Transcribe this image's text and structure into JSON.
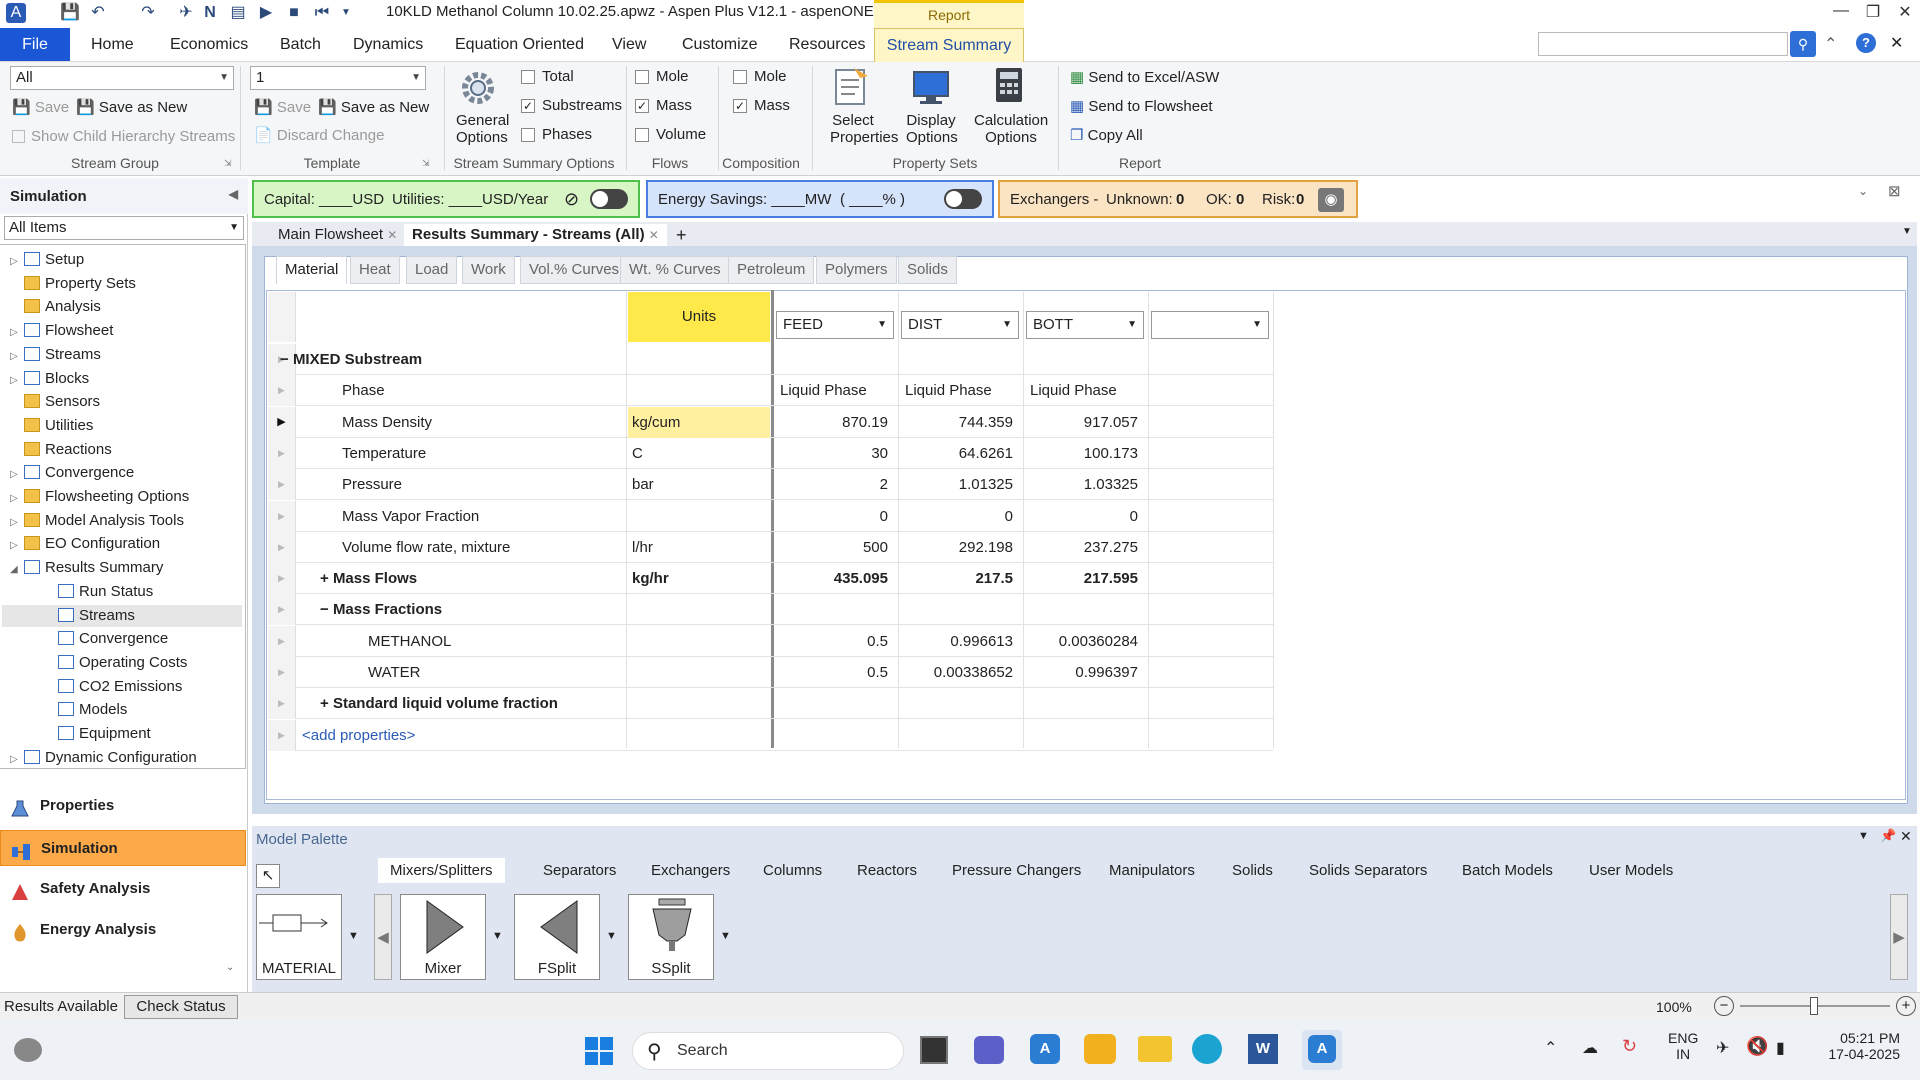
{
  "window": {
    "title": "10KLD Methanol Column 10.02.25.apwz - Aspen Plus V12.1 - aspenONE",
    "context_tab": "Report"
  },
  "ribbon_tabs": [
    "File",
    "Home",
    "Economics",
    "Batch",
    "Dynamics",
    "Equation Oriented",
    "View",
    "Customize",
    "Resources",
    "Stream Summary"
  ],
  "ribbon": {
    "stream_group": {
      "combo": "All",
      "save": "Save",
      "save_as_new": "Save as New",
      "show_child": "Show Child Hierarchy Streams",
      "label": "Stream Group"
    },
    "template": {
      "combo": "1",
      "save": "Save",
      "save_as_new": "Save as New",
      "discard": "Discard Change",
      "label": "Template"
    },
    "options": {
      "general": "General",
      "general2": "Options",
      "total": "Total",
      "substreams": "Substreams",
      "phases": "Phases",
      "label": "Stream Summary Options"
    },
    "flows": {
      "mole": "Mole",
      "mass": "Mass",
      "volume": "Volume",
      "label": "Flows"
    },
    "composition": {
      "mole": "Mole",
      "mass": "Mass",
      "label": "Composition"
    },
    "property_sets": {
      "select": "Select",
      "select2": "Properties",
      "display": "Display",
      "display2": "Options",
      "calc": "Calculation",
      "calc2": "Options",
      "label": "Property Sets"
    },
    "report": {
      "excel": "Send to Excel/ASW",
      "flowsheet": "Send to Flowsheet",
      "copy": "Copy All",
      "label": "Report"
    }
  },
  "nav": {
    "header": "Simulation",
    "filter": "All Items",
    "tree": [
      {
        "label": "Setup",
        "level": 0,
        "exp": true,
        "icon": "doc"
      },
      {
        "label": "Property Sets",
        "level": 0,
        "exp": false,
        "icon": "folder"
      },
      {
        "label": "Analysis",
        "level": 0,
        "exp": false,
        "icon": "folder"
      },
      {
        "label": "Flowsheet",
        "level": 0,
        "exp": true,
        "icon": "doc"
      },
      {
        "label": "Streams",
        "level": 0,
        "exp": true,
        "icon": "doc"
      },
      {
        "label": "Blocks",
        "level": 0,
        "exp": true,
        "icon": "doc"
      },
      {
        "label": "Sensors",
        "level": 0,
        "exp": false,
        "icon": "folder"
      },
      {
        "label": "Utilities",
        "level": 0,
        "exp": false,
        "icon": "folder"
      },
      {
        "label": "Reactions",
        "level": 0,
        "exp": false,
        "icon": "folder"
      },
      {
        "label": "Convergence",
        "level": 0,
        "exp": true,
        "icon": "doc"
      },
      {
        "label": "Flowsheeting Options",
        "level": 0,
        "exp": true,
        "icon": "folder"
      },
      {
        "label": "Model Analysis Tools",
        "level": 0,
        "exp": true,
        "icon": "folder"
      },
      {
        "label": "EO Configuration",
        "level": 0,
        "exp": true,
        "icon": "folder"
      },
      {
        "label": "Results Summary",
        "level": 0,
        "exp": true,
        "icon": "doc",
        "open": true
      },
      {
        "label": "Run Status",
        "level": 1,
        "icon": "doc"
      },
      {
        "label": "Streams",
        "level": 1,
        "icon": "doc",
        "selected": true
      },
      {
        "label": "Convergence",
        "level": 1,
        "icon": "doc"
      },
      {
        "label": "Operating Costs",
        "level": 1,
        "icon": "doc"
      },
      {
        "label": "CO2 Emissions",
        "level": 1,
        "icon": "doc"
      },
      {
        "label": "Models",
        "level": 1,
        "icon": "doc"
      },
      {
        "label": "Equipment",
        "level": 1,
        "icon": "doc"
      },
      {
        "label": "Dynamic Configuration",
        "level": 0,
        "exp": true,
        "icon": "doc"
      }
    ],
    "buttons": [
      "Properties",
      "Simulation",
      "Safety Analysis",
      "Energy Analysis"
    ]
  },
  "infobar": {
    "capital": "Capital: ____USD",
    "utilities": "Utilities: ____USD/Year",
    "energy": "Energy Savings: ____MW",
    "percent": "( ____% )",
    "exchangers": "Exchangers -",
    "unknown_label": "Unknown:",
    "unknown": "0",
    "ok_label": "OK:",
    "ok": "0",
    "risk_label": "Risk:",
    "risk": "0"
  },
  "doc_tabs": [
    "Main Flowsheet",
    "Results Summary - Streams (All)"
  ],
  "sub_tabs": [
    "Material",
    "Heat",
    "Load",
    "Work",
    "Vol.% Curves",
    "Wt. % Curves",
    "Petroleum",
    "Polymers",
    "Solids"
  ],
  "grid": {
    "units_header": "Units",
    "streams": [
      "FEED",
      "DIST",
      "BOTT",
      ""
    ],
    "rows": [
      {
        "label": "MIXED Substream",
        "indent": 0,
        "bold": true,
        "sign": "−",
        "units": "",
        "v": [
          "",
          "",
          ""
        ]
      },
      {
        "label": "Phase",
        "indent": 1,
        "units": "",
        "v": [
          "Liquid Phase",
          "Liquid Phase",
          "Liquid Phase"
        ],
        "text": true
      },
      {
        "label": "Mass Density",
        "indent": 1,
        "units": "kg/cum",
        "v": [
          "870.19",
          "744.359",
          "917.057"
        ],
        "current": true
      },
      {
        "label": "Temperature",
        "indent": 1,
        "units": "C",
        "v": [
          "30",
          "64.6261",
          "100.173"
        ]
      },
      {
        "label": "Pressure",
        "indent": 1,
        "units": "bar",
        "v": [
          "2",
          "1.01325",
          "1.03325"
        ]
      },
      {
        "label": "Mass Vapor Fraction",
        "indent": 1,
        "units": "",
        "v": [
          "0",
          "0",
          "0"
        ]
      },
      {
        "label": "Volume flow rate, mixture",
        "indent": 1,
        "units": "l/hr",
        "v": [
          "500",
          "292.198",
          "237.275"
        ]
      },
      {
        "label": "Mass Flows",
        "indent": 1,
        "bold": true,
        "sign": "+",
        "units": "kg/hr",
        "v": [
          "435.095",
          "217.5",
          "217.595"
        ]
      },
      {
        "label": "Mass Fractions",
        "indent": 1,
        "bold": true,
        "sign": "−",
        "units": "",
        "v": [
          "",
          "",
          ""
        ]
      },
      {
        "label": "METHANOL",
        "indent": 2,
        "units": "",
        "v": [
          "0.5",
          "0.996613",
          "0.00360284"
        ]
      },
      {
        "label": "WATER",
        "indent": 2,
        "units": "",
        "v": [
          "0.5",
          "0.00338652",
          "0.996397"
        ]
      },
      {
        "label": "Standard liquid volume fraction",
        "indent": 1,
        "bold": true,
        "sign": "+",
        "units": "",
        "v": [
          "",
          "",
          ""
        ]
      },
      {
        "label": "<add properties>",
        "indent": 0,
        "link": true,
        "units": "",
        "v": [
          "",
          "",
          ""
        ]
      }
    ]
  },
  "palette": {
    "title": "Model Palette",
    "tabs": [
      "Mixers/Splitters",
      "Separators",
      "Exchangers",
      "Columns",
      "Reactors",
      "Pressure Changers",
      "Manipulators",
      "Solids",
      "Solids Separators",
      "Batch Models",
      "User Models"
    ],
    "items": [
      "MATERIAL",
      "Mixer",
      "FSplit",
      "SSplit"
    ]
  },
  "status": {
    "text": "Results Available",
    "check": "Check Status",
    "zoom": "100%"
  },
  "taskbar": {
    "search": "Search",
    "lang1": "ENG",
    "lang2": "IN",
    "time": "05:21 PM",
    "date": "17-04-2025"
  },
  "colors": {
    "file_tab": "#1a56d6",
    "context": "#fff6c8",
    "active_nav": "#fca94a",
    "units_header": "#ffe84a"
  }
}
